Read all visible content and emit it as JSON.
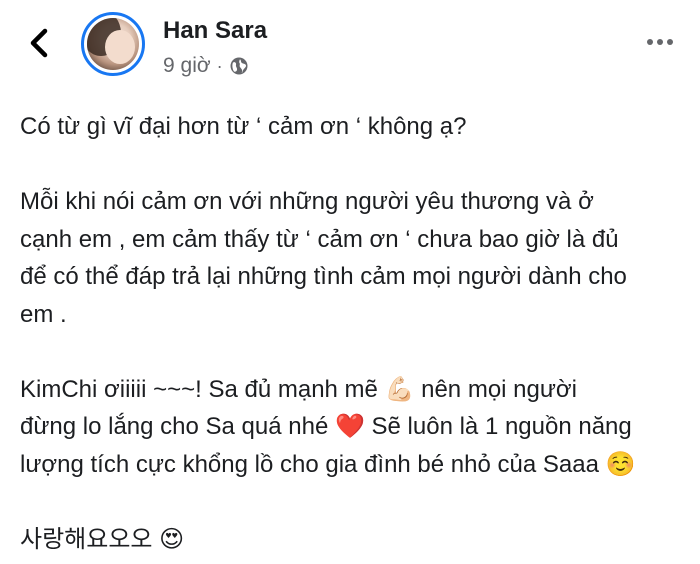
{
  "post": {
    "author_name": "Han Sara",
    "time": "9 giờ",
    "separator": "·",
    "privacy_icon": "globe-icon",
    "paragraphs": [
      "Có từ gì vĩ đại hơn từ ‘ cảm ơn ‘ không ạ?",
      "Mỗi khi nói cảm ơn với những người yêu thương và ở\ncạnh em , em cảm thấy từ ‘ cảm ơn ‘ chưa bao giờ là đủ\nđể có thể đáp trả lại những tình cảm mọi người dành cho\nem .",
      "KimChi ơiiiii ~~~!  Sa đủ mạnh mẽ 💪🏻 nên mọi người\nđừng lo lắng cho Sa quá nhé ❤️  Sẽ luôn là 1 nguồn năng\nlượng tích cực khổng lồ cho gia đình bé nhỏ của Saaa ☺️",
      "사랑해요오오 😍"
    ]
  },
  "toolbar": {
    "back_icon": "back-arrow-icon",
    "more_icon": "more-options-icon"
  },
  "colors": {
    "story_ring": "#1877f2",
    "text_primary": "#1c1e21",
    "text_secondary": "#65676b"
  }
}
